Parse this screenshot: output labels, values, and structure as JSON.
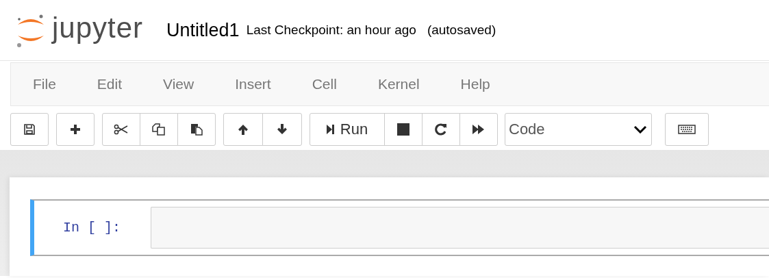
{
  "header": {
    "logo_text": "jupyter",
    "title": "Untitled1",
    "checkpoint": "Last Checkpoint: an hour ago",
    "autosave": "(autosaved)"
  },
  "menubar": [
    "File",
    "Edit",
    "View",
    "Insert",
    "Cell",
    "Kernel",
    "Help"
  ],
  "toolbar": [
    {
      "kind": "group",
      "buttons": [
        {
          "kind": "save"
        }
      ]
    },
    {
      "kind": "group",
      "buttons": [
        {
          "kind": "add"
        }
      ]
    },
    {
      "kind": "group",
      "buttons": [
        {
          "kind": "cut"
        },
        {
          "kind": "copy"
        },
        {
          "kind": "paste"
        }
      ]
    },
    {
      "kind": "group",
      "buttons": [
        {
          "kind": "up"
        },
        {
          "kind": "down"
        }
      ]
    },
    {
      "kind": "group",
      "buttons": [
        {
          "kind": "run",
          "label": "Run"
        },
        {
          "kind": "stop"
        },
        {
          "kind": "restart"
        },
        {
          "kind": "fastforward"
        }
      ]
    },
    {
      "kind": "select",
      "value": "Code"
    },
    {
      "kind": "group",
      "buttons": [
        {
          "kind": "keyboard"
        }
      ]
    }
  ],
  "cells": [
    {
      "prompt": "In [ ]:",
      "selected": true
    }
  ]
}
